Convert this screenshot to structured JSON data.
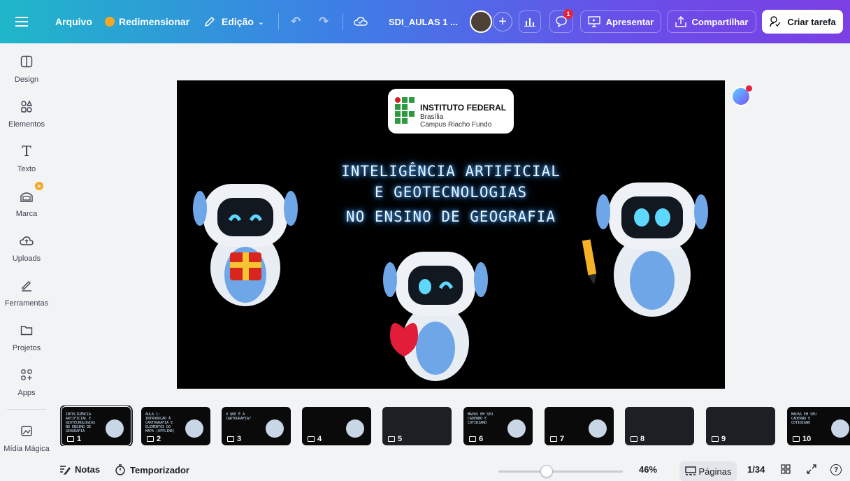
{
  "topbar": {
    "arquivo": "Arquivo",
    "redimensionar": "Redimensionar",
    "edicao": "Edição",
    "doc_title": "SDI_AULAS 1 ...",
    "comment_badge": "1",
    "apresentar": "Apresentar",
    "compartilhar": "Compartilhar",
    "criar_tarefa": "Criar tarefa"
  },
  "sidebar": {
    "items": [
      {
        "label": "Design",
        "icon": "design-icon"
      },
      {
        "label": "Elementos",
        "icon": "elements-icon"
      },
      {
        "label": "Texto",
        "icon": "text-icon"
      },
      {
        "label": "Marca",
        "icon": "brand-icon"
      },
      {
        "label": "Uploads",
        "icon": "upload-icon"
      },
      {
        "label": "Ferramentas",
        "icon": "tools-icon"
      },
      {
        "label": "Projetos",
        "icon": "folder-icon"
      },
      {
        "label": "Apps",
        "icon": "apps-icon"
      },
      {
        "label": "Mídia Mágica",
        "icon": "magic-media-icon"
      }
    ]
  },
  "slide": {
    "logo_line1": "INSTITUTO FEDERAL",
    "logo_line2": "Brasília",
    "logo_line3": "Campus Riacho Fundo",
    "title_line1": "INTELIGÊNCIA ARTIFICIAL",
    "title_line2": "E GEOTECNOLOGIAS",
    "title_line3": "NO ENSINO DE GEOGRAFIA"
  },
  "thumbnails": [
    {
      "num": "1",
      "text": "INTELIGÊNCIA ARTIFICIAL E GEOTECNOLOGIAS NO ENSINO DE GEOGRAFIA"
    },
    {
      "num": "2",
      "text": "AULA 1: INTRODUÇÃO À CARTOGRAFIA E ELEMENTOS DO MAPA (OFFLINE)"
    },
    {
      "num": "3",
      "text": "O QUE É A CARTOGRAFIA?"
    },
    {
      "num": "4",
      "text": ""
    },
    {
      "num": "5",
      "text": ""
    },
    {
      "num": "6",
      "text": "MAPAS EM SEU CADERNO E COTIDIANO"
    },
    {
      "num": "7",
      "text": ""
    },
    {
      "num": "8",
      "text": ""
    },
    {
      "num": "9",
      "text": ""
    },
    {
      "num": "10",
      "text": "MAPAS EM SEU CADERNO E COTIDIANO"
    }
  ],
  "bottom": {
    "notas": "Notas",
    "temporizador": "Temporizador",
    "zoom": "46%",
    "zoom_value": 0.46,
    "paginas": "Páginas",
    "page_counter": "1/34"
  }
}
